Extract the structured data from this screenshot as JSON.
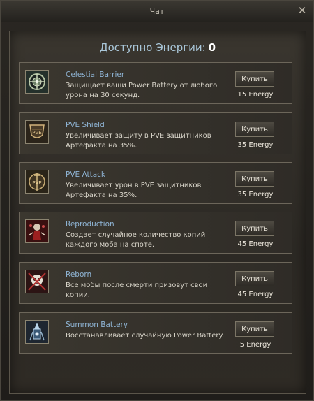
{
  "window": {
    "title": "Чат"
  },
  "energy": {
    "label": "Доступно Энергии:",
    "value": "0"
  },
  "items": [
    {
      "name": "Celestial Barrier",
      "description": "Защищает ваши Power Battery от любого урона на 30 секунд.",
      "button": "Купить",
      "cost": "15 Energy",
      "icon": "celestial-barrier-icon"
    },
    {
      "name": "PVE Shield",
      "description": "Увеличивает защиту в PVE защитников Артефакта на 35%.",
      "button": "Купить",
      "cost": "35 Energy",
      "icon": "pve-shield-icon"
    },
    {
      "name": "PVE Attack",
      "description": "Увеличивает урон в PVE защитников Артефакта на 35%.",
      "button": "Купить",
      "cost": "35 Energy",
      "icon": "pve-attack-icon"
    },
    {
      "name": "Reproduction",
      "description": "Создает случайное количество копий каждого моба на споте.",
      "button": "Купить",
      "cost": "45 Energy",
      "icon": "reproduction-icon"
    },
    {
      "name": "Reborn",
      "description": "Все мобы после смерти призовут свои копии.",
      "button": "Купить",
      "cost": "45 Energy",
      "icon": "reborn-icon"
    },
    {
      "name": "Summon Battery",
      "description": "Восстанавливает случайную Power Battery.",
      "button": "Купить",
      "cost": "5 Energy",
      "icon": "summon-battery-icon"
    }
  ]
}
